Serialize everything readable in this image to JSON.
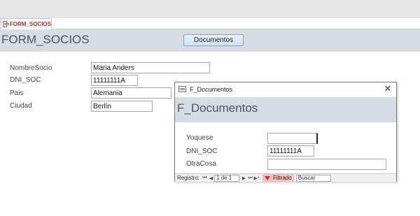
{
  "tab": {
    "label": "FORM_SOCIOS"
  },
  "main_form": {
    "title": "FORM_SOCIOS",
    "documents_button": "Documentos",
    "fields": [
      {
        "label": "NombreSocio",
        "value": "Maria Anders"
      },
      {
        "label": "DNI_SOC",
        "value": "11111111A"
      },
      {
        "label": "Pais",
        "value": "Alemania"
      },
      {
        "label": "Ciudad",
        "value": "Berlín"
      }
    ]
  },
  "popup": {
    "window_title": "F_Documentos",
    "heading": "F_Documentos",
    "close_glyph": "✕",
    "fields": [
      {
        "label": "Yoquese",
        "value": ""
      },
      {
        "label": "DNI_SOC",
        "value": "11111111A"
      },
      {
        "label": "OtraCosa",
        "value": ""
      }
    ],
    "navigation": {
      "record_label": "Registro:",
      "position": "1 de 1",
      "filter_label": "Filtrado",
      "search_label": "Buscar"
    }
  }
}
